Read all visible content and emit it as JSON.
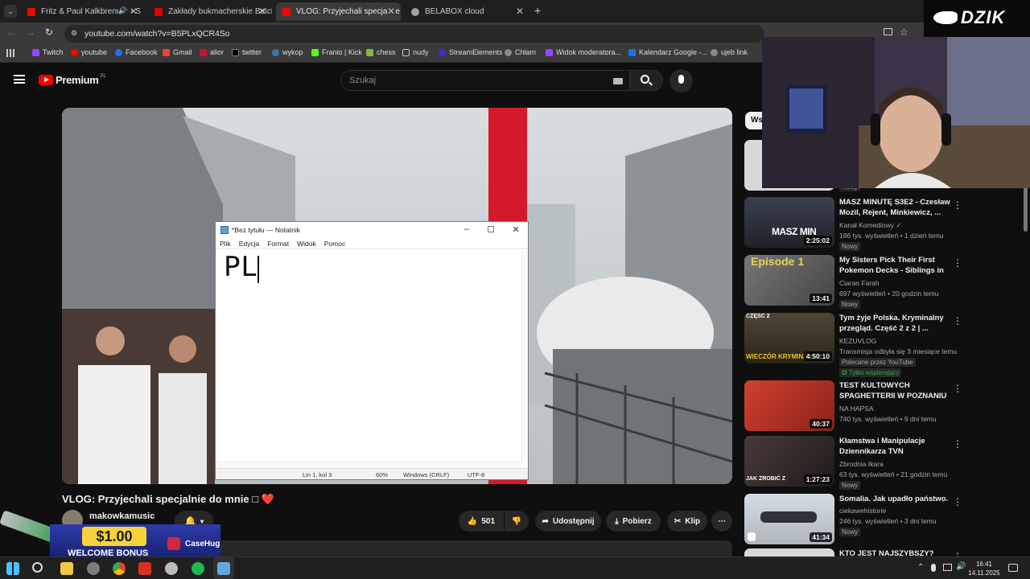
{
  "browser": {
    "tabs": [
      {
        "label": "Fritz & Paul Kalkbrenner - S",
        "favicon_color": "#ff0000",
        "active": false
      },
      {
        "label": "Zakłady bukmacherskie Betclic",
        "favicon_color": "#e40000",
        "active": false
      },
      {
        "label": "VLOG: Przyjechali specjalnie do",
        "favicon_color": "#ff0000",
        "active": true
      },
      {
        "label": "BELABOX cloud",
        "favicon_color": "#9aa0a6",
        "active": false
      }
    ],
    "tab_close": "✕",
    "new_tab": "+",
    "url": "youtube.com/watch?v=B5PLxQCR4So",
    "bookmarks": [
      {
        "label": "Twitch",
        "color": "#9146ff"
      },
      {
        "label": "youtube",
        "color": "#ff0000"
      },
      {
        "label": "Facebook",
        "color": "#1877f2"
      },
      {
        "label": "Gmail",
        "color": "#ea4335"
      },
      {
        "label": "alior",
        "color": "#c8102e"
      },
      {
        "label": "twitter",
        "color": "#000000"
      },
      {
        "label": "wykop",
        "color": "#367aa9"
      },
      {
        "label": "Franio | Kick",
        "color": "#53fc18"
      },
      {
        "label": "chess",
        "color": "#81b64c"
      },
      {
        "label": "nudy",
        "color": "#8a8a8a"
      },
      {
        "label": "StreamElements",
        "color": "#3d2bd0"
      },
      {
        "label": "Chłam",
        "color": "#8a8a8a"
      },
      {
        "label": "Widok moderatora...",
        "color": "#9146ff"
      },
      {
        "label": "Kalendarz Google -...",
        "color": "#1a73e8"
      },
      {
        "label": "ujeb link",
        "color": "#8a8a8a"
      }
    ]
  },
  "youtube": {
    "logo_text": "Premium",
    "logo_sup": "PL",
    "search_placeholder": "Szukaj",
    "video_title": "VLOG: Przyjechali specjalnie do mnie □ ❤️",
    "channel_name": "makowkamusic",
    "actions": {
      "likes": "501",
      "share": "Udostępnij",
      "download": "Pobierz",
      "clip": "Klip",
      "more": "⋯"
    },
    "chip_label": "Wsz",
    "recommendations": [
      {
        "title": "",
        "channel": "",
        "meta": "",
        "badge": "Nowy",
        "duration": "",
        "thumb_color": "#c8c8c8"
      },
      {
        "title": "MASZ MINUTĘ S3E2  - Czesław Mozil, Rejent, Minkiewicz, ...",
        "channel": "Kanał Komediowy ✓",
        "meta": "196 tys. wyświetleń • 1 dzień temu",
        "badge": "Nowy",
        "duration": "2:25:02",
        "thumb_color": "#2a2f3a"
      },
      {
        "title": "My Sisters Pick Their First Pokemon Decks - Siblings in t...",
        "channel": "Ciaran Farah",
        "meta": "697 wyświetleń • 20 godzin temu",
        "badge": "Nowy",
        "duration": "13:41",
        "thumb_color": "#5b5a60"
      },
      {
        "title": "Tym żyje Polska. Kryminalny przegląd. Część 2 z 2 | ...",
        "channel": "KEZUVLOG",
        "meta": "Transmisja odbyła się 3 miesiące temu",
        "badge": "Polecane przez YouTube",
        "badge2": "Tylko wspierający",
        "duration": "4:50:10",
        "thumb_color": "#3d3428"
      },
      {
        "title": "TEST KULTOWYCH SPAGHETTERII W POZNANIU",
        "channel": "NA HAPSA",
        "meta": "740 tys. wyświetleń • 9 dni temu",
        "badge": "",
        "duration": "40:37",
        "thumb_color": "#b2332b"
      },
      {
        "title": "Kłamstwa i Manipulacje Dziennikarza TVN",
        "channel": "Zbrodnia Ikara",
        "meta": "63 tys. wyświetleń • 21 godzin temu",
        "badge": "Nowy",
        "duration": "1:27:23",
        "thumb_color": "#3a2e2e"
      },
      {
        "title": "Somalia. Jak upadło państwo.",
        "channel": "ciekawehistorie",
        "meta": "246 tys. wyświetleń • 3 dni temu",
        "badge": "Nowy",
        "duration": "41:34",
        "thumb_color": "#c9d0d6"
      },
      {
        "title": "KTO JEST NAJSZYBSZY?",
        "channel": "",
        "meta": "",
        "badge": "",
        "duration": "",
        "thumb_color": "#d8d8d8"
      }
    ]
  },
  "notepad": {
    "window_title": "*Bez tytułu — Notatnik",
    "menu": [
      "Plik",
      "Edycja",
      "Format",
      "Widok",
      "Pomoc"
    ],
    "content": "PL",
    "status": {
      "position": "Lin 1, kol 3",
      "zoom": "60%",
      "line_endings": "Windows (CRLF)",
      "encoding": "UTF-8"
    }
  },
  "overlay": {
    "brand": "DZIK",
    "promo_amount": "$1.00",
    "promo_text": "WELCOME BONUS",
    "promo_brand": "CaseHug"
  },
  "taskbar": {
    "time": "16:41",
    "date": "14.11.2025"
  }
}
